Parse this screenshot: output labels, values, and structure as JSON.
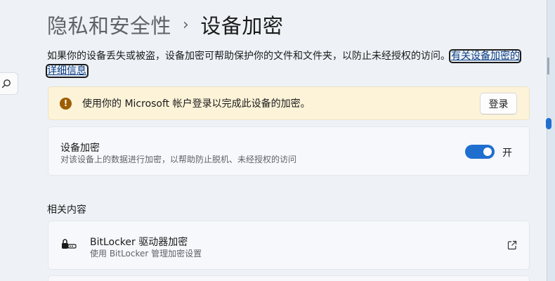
{
  "breadcrumb": {
    "parent": "隐私和安全性",
    "separator": "›",
    "current": "设备加密"
  },
  "intro": {
    "text": "如果你的设备丢失或被盗，设备加密可帮助保护你的文件和文件夹，以防止未经授权的访问。",
    "link": "有关设备加密的详细信息"
  },
  "warning": {
    "icon": "warning-icon",
    "text": "使用你的 Microsoft 帐户登录以完成此设备的加密。",
    "button": "登录"
  },
  "setting": {
    "title": "设备加密",
    "description": "对该设备上的数据进行加密，以帮助防止脱机、未经授权的访问",
    "toggle_on": true,
    "toggle_label": "开"
  },
  "related": {
    "header": "相关内容",
    "items": [
      {
        "icon": "bitlocker-key-icon",
        "title": "BitLocker 驱动器加密",
        "description": "使用 BitLocker 管理加密设置",
        "trailing_icon": "external-link-icon"
      }
    ]
  },
  "colors": {
    "accent": "#1f6fcf",
    "warning_bg": "#fcf3d8",
    "warning_icon": "#9d5d00",
    "link": "#0b3d86"
  }
}
